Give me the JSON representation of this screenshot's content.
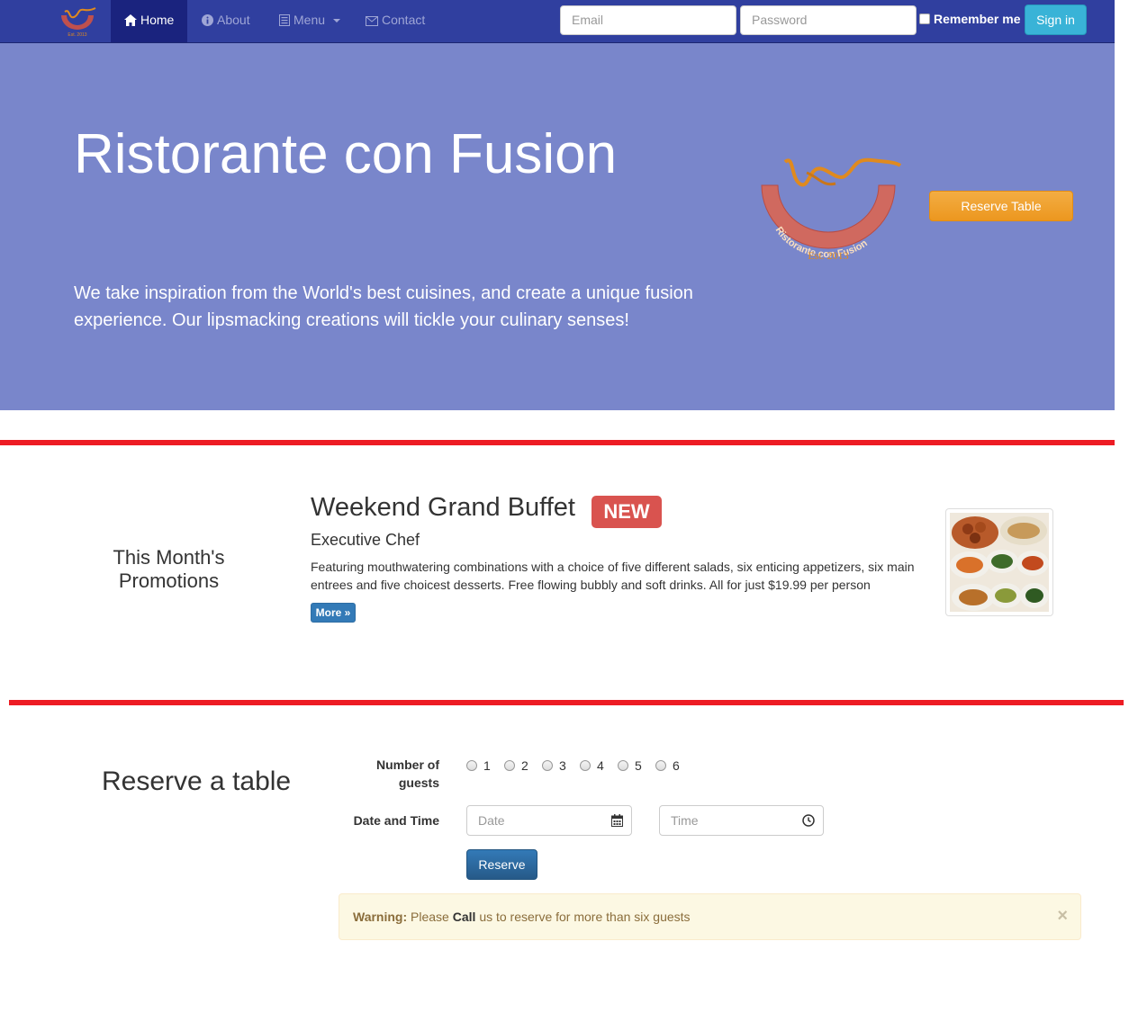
{
  "nav": {
    "items": [
      {
        "label": "Home",
        "icon": "home-icon"
      },
      {
        "label": "About",
        "icon": "info-icon"
      },
      {
        "label": "Menu",
        "icon": "list-icon"
      },
      {
        "label": "Contact",
        "icon": "envelope-icon"
      }
    ],
    "email_placeholder": "Email",
    "password_placeholder": "Password",
    "remember_label": "Remember me",
    "signin_label": "Sign in"
  },
  "jumbotron": {
    "title": "Ristorante con Fusion",
    "description": "We take inspiration from the World's best cuisines, and create a unique fusion experience. Our lipsmacking creations will tickle your culinary senses!",
    "reserve_button": "Reserve Table",
    "logo_text": "Ristorante con Fusion",
    "logo_est": "Est. 2013"
  },
  "promotions": {
    "label": "This Month's Promotions",
    "title": "Weekend Grand Buffet",
    "badge": "NEW",
    "subtitle": "Executive Chef",
    "description": "Featuring mouthwatering combinations with a choice of five different salads, six enticing appetizers, six main entrees and five choicest desserts. Free flowing bubbly and soft drinks. All for just $19.99 per person",
    "more_button": "More »"
  },
  "reservation": {
    "heading": "Reserve a table",
    "guests_label": "Number of guests",
    "guest_options": [
      "1",
      "2",
      "3",
      "4",
      "5",
      "6"
    ],
    "datetime_label": "Date and Time",
    "date_placeholder": "Date",
    "time_placeholder": "Time",
    "submit_label": "Reserve",
    "warning_prefix": "Warning:",
    "warning_please": "Please",
    "warning_call": "Call",
    "warning_rest": "us to reserve for more than six guests",
    "close_symbol": "×"
  },
  "colors": {
    "navbar": "#303F9F",
    "navbar_active": "#1A237E",
    "jumbotron": "#7986CB",
    "accent_orange": "#F0A030",
    "divider_red": "#ED1C24",
    "badge_red": "#D9534F"
  }
}
